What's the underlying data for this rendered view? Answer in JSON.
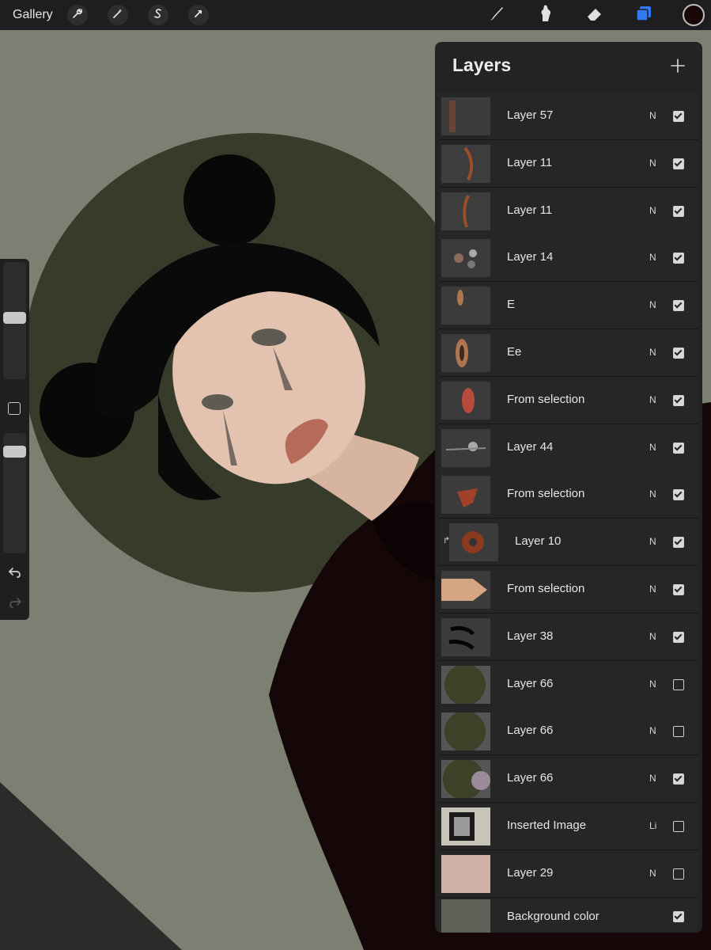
{
  "toolbar": {
    "gallery_label": "Gallery",
    "left_icons": [
      "wrench-icon",
      "magic-wand-icon",
      "selection-s-icon",
      "transform-arrow-icon"
    ],
    "right_tools": [
      "brush-icon",
      "smudge-icon",
      "eraser-icon",
      "layers-icon"
    ],
    "active_tool": "layers-icon",
    "accent_color": "#2f7bf6",
    "current_color": "#1a0707"
  },
  "sidebar": {
    "brush_size_level": 0.53,
    "opacity_level": 0.12,
    "icons": [
      "modify-square-icon",
      "undo-icon",
      "redo-icon"
    ]
  },
  "layers": {
    "title": "Layers",
    "add_icon": "plus-icon",
    "items": [
      {
        "name": "Layer 57",
        "blend": "N",
        "visible": true
      },
      {
        "name": "Layer 11",
        "blend": "N",
        "visible": true
      },
      {
        "name": "Layer 11",
        "blend": "N",
        "visible": true
      },
      {
        "name": "Layer 14",
        "blend": "N",
        "visible": true
      },
      {
        "name": "E",
        "blend": "N",
        "visible": true
      },
      {
        "name": "Ee",
        "blend": "N",
        "visible": true
      },
      {
        "name": "From selection",
        "blend": "N",
        "visible": true
      },
      {
        "name": "Layer 44",
        "blend": "N",
        "visible": true
      },
      {
        "name": "From selection",
        "blend": "N",
        "visible": true
      },
      {
        "name": "Layer 10",
        "blend": "N",
        "visible": true,
        "clipped": true
      },
      {
        "name": "From selection",
        "blend": "N",
        "visible": true
      },
      {
        "name": "Layer 38",
        "blend": "N",
        "visible": true
      },
      {
        "name": "Layer 66",
        "blend": "N",
        "visible": false
      },
      {
        "name": "Layer 66",
        "blend": "N",
        "visible": false
      },
      {
        "name": "Layer 66",
        "blend": "N",
        "visible": true
      },
      {
        "name": "Inserted Image",
        "blend": "Li",
        "visible": false
      },
      {
        "name": "Layer 29",
        "blend": "N",
        "visible": false
      },
      {
        "name": "Background color",
        "blend": "",
        "visible": true
      }
    ]
  }
}
